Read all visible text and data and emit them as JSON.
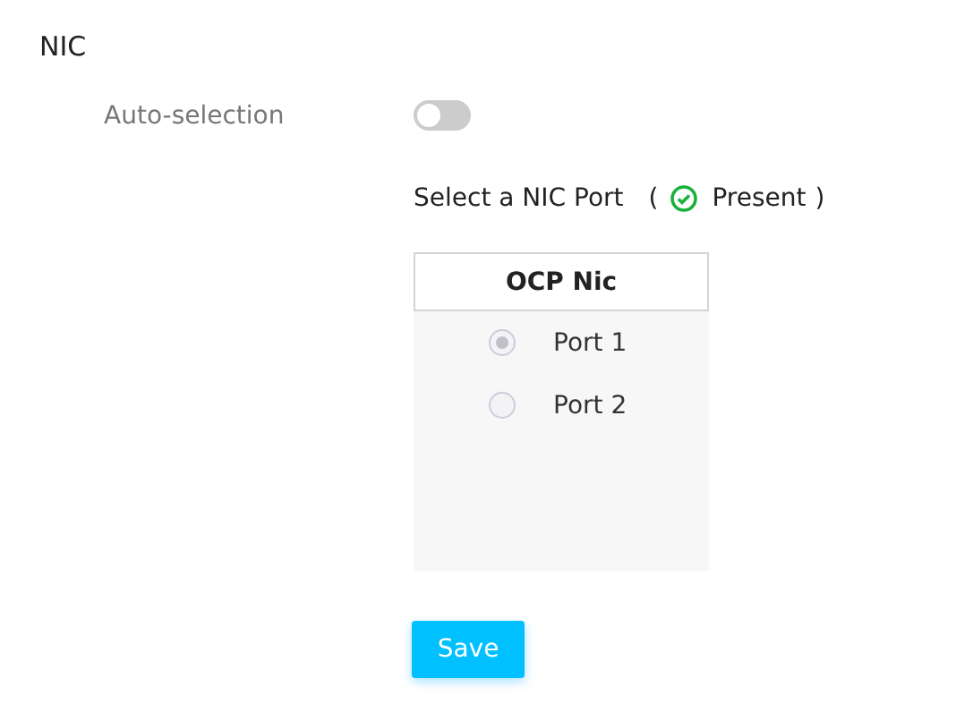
{
  "section": {
    "title": "NIC"
  },
  "auto_selection": {
    "label": "Auto-selection",
    "on": false
  },
  "port_select": {
    "label": "Select a NIC Port",
    "open": "(",
    "status": "Present",
    "close": ")"
  },
  "table": {
    "header": "OCP Nic",
    "ports": [
      {
        "label": "Port 1",
        "selected": true,
        "disabled": true
      },
      {
        "label": "Port 2",
        "selected": false,
        "disabled": true
      }
    ]
  },
  "buttons": [
    "Save"
  ]
}
